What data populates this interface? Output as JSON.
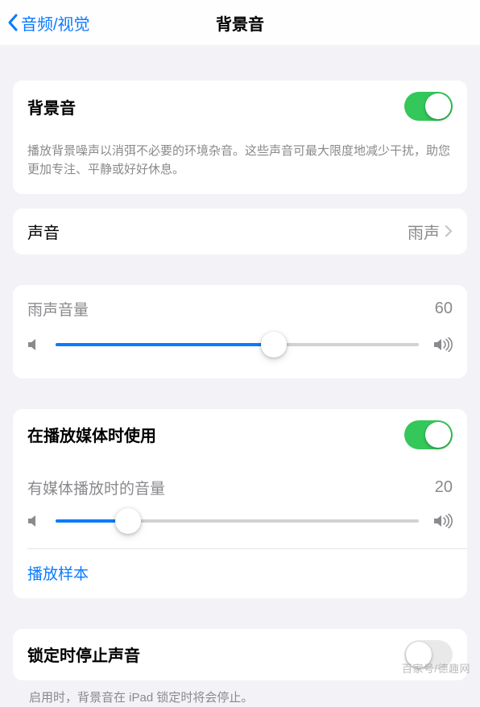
{
  "nav": {
    "back_label": "音频/视觉",
    "title": "背景音"
  },
  "section1": {
    "title": "背景音",
    "toggle_on": true,
    "description": "播放背景噪声以消弭不必要的环境杂音。这些声音可最大限度地减少干扰，助您更加专注、平静或好好休息。"
  },
  "soundRow": {
    "label": "声音",
    "value": "雨声"
  },
  "volume1": {
    "label": "雨声音量",
    "value": 60
  },
  "mediaSection": {
    "toggle_label": "在播放媒体时使用",
    "toggle_on": true,
    "volume_label": "有媒体播放时的音量",
    "volume_value": 20,
    "sample_link": "播放样本"
  },
  "lockSection": {
    "label": "锁定时停止声音",
    "toggle_on": false,
    "description": "启用时，背景音在 iPad 锁定时将会停止。"
  },
  "watermark": "百家号/德趣网"
}
